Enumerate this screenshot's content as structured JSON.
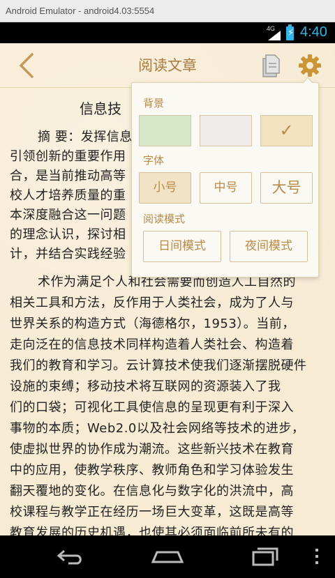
{
  "window": {
    "title": "Android Emulator - android4.03:5554"
  },
  "status_bar": {
    "network": "4G",
    "time": "4:40",
    "accent": "#33b5e5"
  },
  "header": {
    "title": "阅读文章",
    "back_icon": "chevron-left-icon",
    "doc_icon": "document-icon",
    "settings_icon": "gear-icon"
  },
  "article": {
    "title": "信息技",
    "lines": [
      "摘 要：发挥信息",
      "引领创新的重要作用",
      "合，是当前推动高等",
      "校人才培养质量的重",
      "本深度融合这一问题",
      "的理念认识，探讨相",
      "计，并结合实践经验",
      "术作为满足个人和社会需要而创造人工自然的",
      "相关工具和方法，反作用于人类社会，成为了人与",
      "世界关系的构造方式（海德格尔，1953）。当前，",
      "走向泛在的信息技术同样构造着人类社会、构造着",
      "我们的教育和学习。云计算技术使我们逐渐摆脱硬件",
      "设施的束缚；移动技术将互联网的资源装入了我",
      "们的口袋；可视化工具使信息的呈现更有利于深入",
      "事物的本质；Web2.0以及社会网络等技术的进步，",
      "使虚拟世界的协作成为潮流。这些新兴技术在教育",
      "中的应用，使教学秩序、教师角色和学习体验发生",
      "翻天覆地的变化。在信息化与数字化的洪流中，高",
      "校课程与教学正在经历一场巨大变革，这既是高等",
      "教育发展的历史机遇，也使其必须面临前所未有的"
    ]
  },
  "settings_popup": {
    "background_label": "背景",
    "backgrounds": [
      {
        "name": "green",
        "color": "#d6e8c8",
        "selected": false
      },
      {
        "name": "gray",
        "color": "#eeebe8",
        "selected": false
      },
      {
        "name": "parchment",
        "color": "#f2e2c0",
        "selected": true
      }
    ],
    "check_mark": "✓",
    "font_label": "字体",
    "font_sizes": [
      {
        "label": "小号",
        "selected": true
      },
      {
        "label": "中号",
        "selected": false
      },
      {
        "label": "大号",
        "selected": false
      }
    ],
    "mode_label": "阅读模式",
    "modes": [
      {
        "label": "日间模式"
      },
      {
        "label": "夜间模式"
      }
    ]
  },
  "nav_bar": {
    "back_icon": "back-arrow-icon",
    "home_icon": "home-icon",
    "recents_icon": "recent-apps-icon",
    "menu_icon": "overflow-menu-icon"
  },
  "colors": {
    "accent": "#b88a48",
    "paper": "#f7ebd4",
    "text": "#222222"
  }
}
